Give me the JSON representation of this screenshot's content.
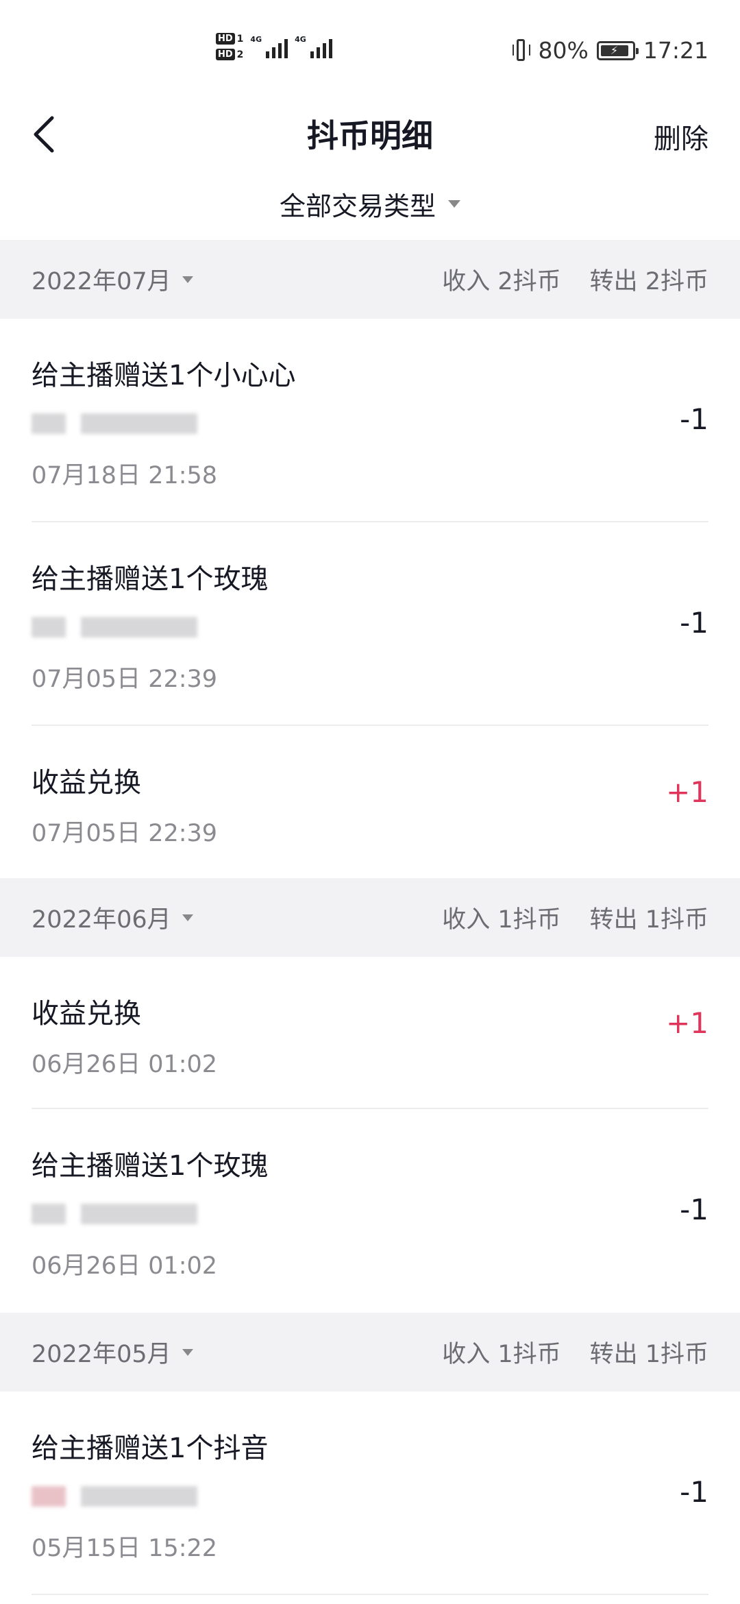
{
  "status_bar": {
    "sim1": "HD",
    "sim1_num": "1",
    "sim2": "HD",
    "sim2_num": "2",
    "net1": "4G",
    "net2": "4G",
    "battery": "80%",
    "time": "17:21"
  },
  "nav": {
    "title": "抖币明细",
    "delete_label": "删除"
  },
  "filter": {
    "label": "全部交易类型"
  },
  "months": [
    {
      "month": "2022年07月",
      "income": "收入 2抖币",
      "outgo": "转出 2抖币",
      "transactions": [
        {
          "title": "给主播赠送1个小心心",
          "date": "07月18日 21:58",
          "amount": "-1"
        },
        {
          "title": "给主播赠送1个玫瑰",
          "date": "07月05日 22:39",
          "amount": "-1"
        },
        {
          "title": "收益兑换",
          "date": "07月05日 22:39",
          "amount": "+1"
        }
      ]
    },
    {
      "month": "2022年06月",
      "income": "收入 1抖币",
      "outgo": "转出 1抖币",
      "transactions": [
        {
          "title": "收益兑换",
          "date": "06月26日 01:02",
          "amount": "+1"
        },
        {
          "title": "给主播赠送1个玫瑰",
          "date": "06月26日 01:02",
          "amount": "-1"
        }
      ]
    },
    {
      "month": "2022年05月",
      "income": "收入 1抖币",
      "outgo": "转出 1抖币",
      "transactions": [
        {
          "title": "给主播赠送1个抖音",
          "date": "05月15日 15:22",
          "amount": "-1"
        }
      ]
    }
  ],
  "colors": {
    "positive": "#e0355a",
    "header_bg": "#f2f2f4"
  }
}
